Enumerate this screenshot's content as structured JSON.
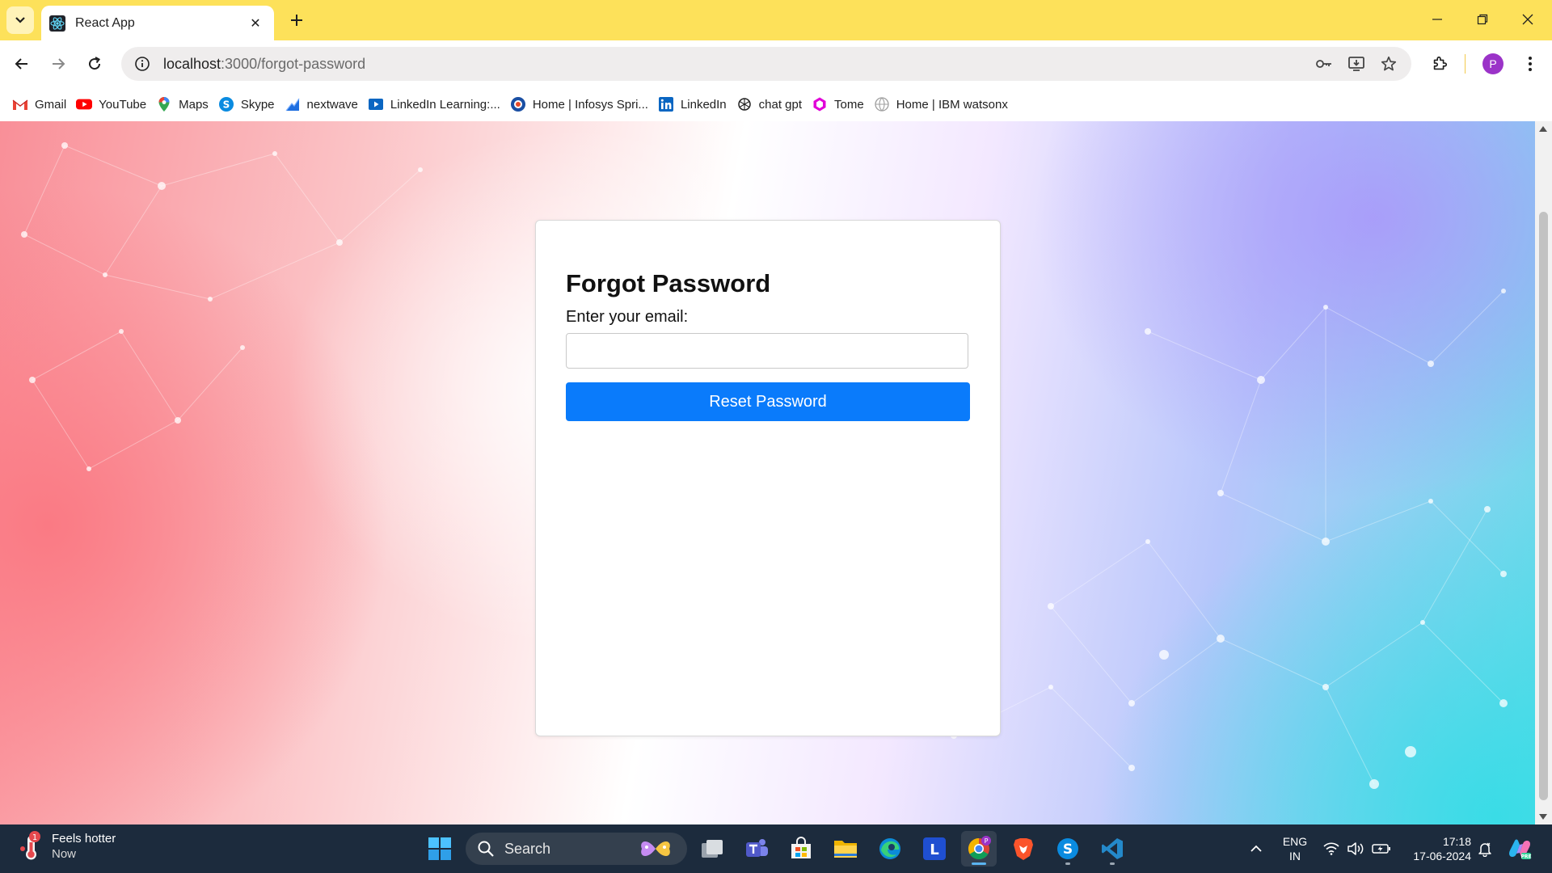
{
  "browser": {
    "tab": {
      "title": "React App"
    },
    "url": {
      "host": "localhost",
      "path": ":3000/forgot-password"
    },
    "profile_initial": "P"
  },
  "bookmarks": [
    {
      "label": "Gmail",
      "icon": "gmail-icon"
    },
    {
      "label": "YouTube",
      "icon": "youtube-icon"
    },
    {
      "label": "Maps",
      "icon": "maps-icon"
    },
    {
      "label": "Skype",
      "icon": "skype-icon"
    },
    {
      "label": "nextwave",
      "icon": "nextwave-icon"
    },
    {
      "label": "LinkedIn Learning:...",
      "icon": "linkedin-learning-icon"
    },
    {
      "label": "Home | Infosys Spri...",
      "icon": "infosys-icon"
    },
    {
      "label": "LinkedIn",
      "icon": "linkedin-icon"
    },
    {
      "label": "chat gpt",
      "icon": "chatgpt-icon"
    },
    {
      "label": "Tome",
      "icon": "tome-icon"
    },
    {
      "label": "Home | IBM watsonx",
      "icon": "watsonx-icon"
    }
  ],
  "page": {
    "title": "Forgot Password",
    "email_label": "Enter your email:",
    "email_value": "",
    "email_placeholder": "",
    "submit_label": "Reset Password",
    "accent_color": "#0a7bfb"
  },
  "taskbar": {
    "weather": {
      "title": "Feels hotter",
      "subtitle": "Now",
      "badge": "1"
    },
    "search_label": "Search",
    "apps": [
      {
        "name": "windows-start-icon"
      },
      {
        "name": "task-view-icon"
      },
      {
        "name": "teams-icon"
      },
      {
        "name": "microsoft-store-icon"
      },
      {
        "name": "file-explorer-icon"
      },
      {
        "name": "edge-icon"
      },
      {
        "name": "l-app-icon",
        "letter": "L"
      },
      {
        "name": "chrome-icon",
        "active": true
      },
      {
        "name": "brave-icon"
      },
      {
        "name": "skype-icon",
        "letter": "S"
      },
      {
        "name": "vscode-icon"
      }
    ],
    "language": {
      "line1": "ENG",
      "line2": "IN"
    },
    "clock": {
      "time": "17:18",
      "date": "17-06-2024"
    }
  }
}
